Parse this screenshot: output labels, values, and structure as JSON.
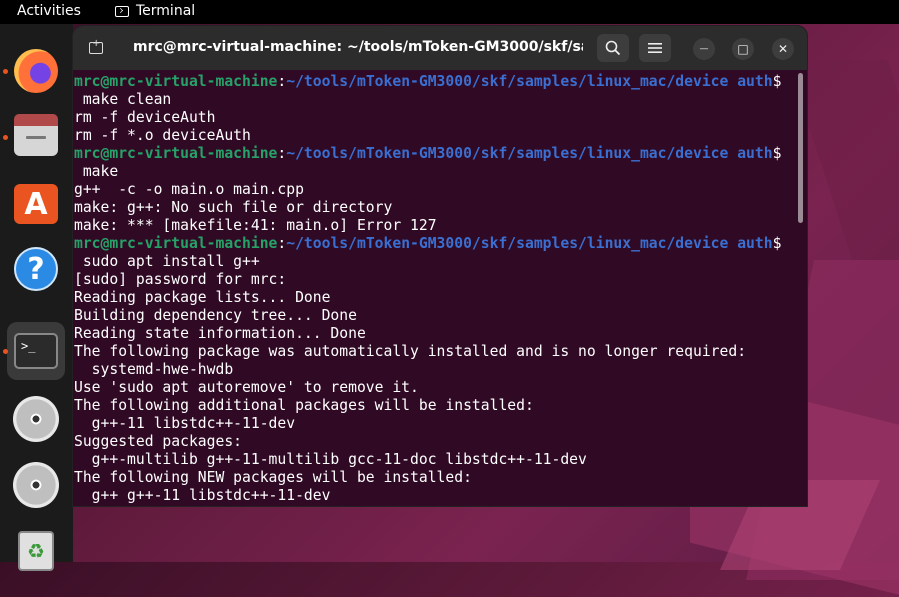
{
  "topbar": {
    "activities": "Activities",
    "app_name": "Terminal"
  },
  "dock": {
    "items": [
      {
        "name": "firefox",
        "icon": "firefox-icon",
        "running": true
      },
      {
        "name": "files",
        "icon": "files-icon",
        "running": true
      },
      {
        "name": "app-center",
        "icon": "store-icon",
        "glyph": "A",
        "running": false
      },
      {
        "name": "help",
        "icon": "help-icon",
        "glyph": "?",
        "running": false
      },
      {
        "name": "terminal",
        "icon": "terminal-icon",
        "glyph": ">_",
        "running": true,
        "active": true
      },
      {
        "name": "disc-1",
        "icon": "disc-icon",
        "running": false
      },
      {
        "name": "disc-2",
        "icon": "disc-icon",
        "running": false
      },
      {
        "name": "trash",
        "icon": "trash-icon",
        "glyph": "♻",
        "running": false
      }
    ]
  },
  "window": {
    "title": "mrc@mrc-virtual-machine: ~/tools/mToken-GM3000/skf/sam...",
    "buttons": {
      "search": "search-icon",
      "menu": "hamburger-icon",
      "minimize": "—",
      "maximize": "□",
      "close": "✕"
    }
  },
  "terminal": {
    "prompt_user": "mrc@mrc-virtual-machine",
    "prompt_path": "~/tools/mToken-GM3000/skf/samples/linux_mac/device auth",
    "lines": [
      {
        "type": "prompt"
      },
      {
        "type": "text",
        "text": " make clean"
      },
      {
        "type": "text",
        "text": "rm -f deviceAuth"
      },
      {
        "type": "text",
        "text": "rm -f *.o deviceAuth"
      },
      {
        "type": "prompt"
      },
      {
        "type": "text",
        "text": " make"
      },
      {
        "type": "text",
        "text": "g++  -c -o main.o main.cpp"
      },
      {
        "type": "text",
        "text": "make: g++: No such file or directory"
      },
      {
        "type": "text",
        "text": "make: *** [makefile:41: main.o] Error 127"
      },
      {
        "type": "prompt"
      },
      {
        "type": "text",
        "text": " sudo apt install g++"
      },
      {
        "type": "text",
        "text": "[sudo] password for mrc:"
      },
      {
        "type": "text",
        "text": "Reading package lists... Done"
      },
      {
        "type": "text",
        "text": "Building dependency tree... Done"
      },
      {
        "type": "text",
        "text": "Reading state information... Done"
      },
      {
        "type": "text",
        "text": "The following package was automatically installed and is no longer required:"
      },
      {
        "type": "text",
        "text": "  systemd-hwe-hwdb"
      },
      {
        "type": "text",
        "text": "Use 'sudo apt autoremove' to remove it."
      },
      {
        "type": "text",
        "text": "The following additional packages will be installed:"
      },
      {
        "type": "text",
        "text": "  g++-11 libstdc++-11-dev"
      },
      {
        "type": "text",
        "text": "Suggested packages:"
      },
      {
        "type": "text",
        "text": "  g++-multilib g++-11-multilib gcc-11-doc libstdc++-11-dev"
      },
      {
        "type": "text",
        "text": "The following NEW packages will be installed:"
      },
      {
        "type": "text",
        "text": "  g++ g++-11 libstdc++-11-dev"
      }
    ]
  },
  "colors": {
    "terminal_bg": "#300a24",
    "prompt_user": "#26a269",
    "prompt_path": "#3a6fd1",
    "accent": "#e95420"
  }
}
